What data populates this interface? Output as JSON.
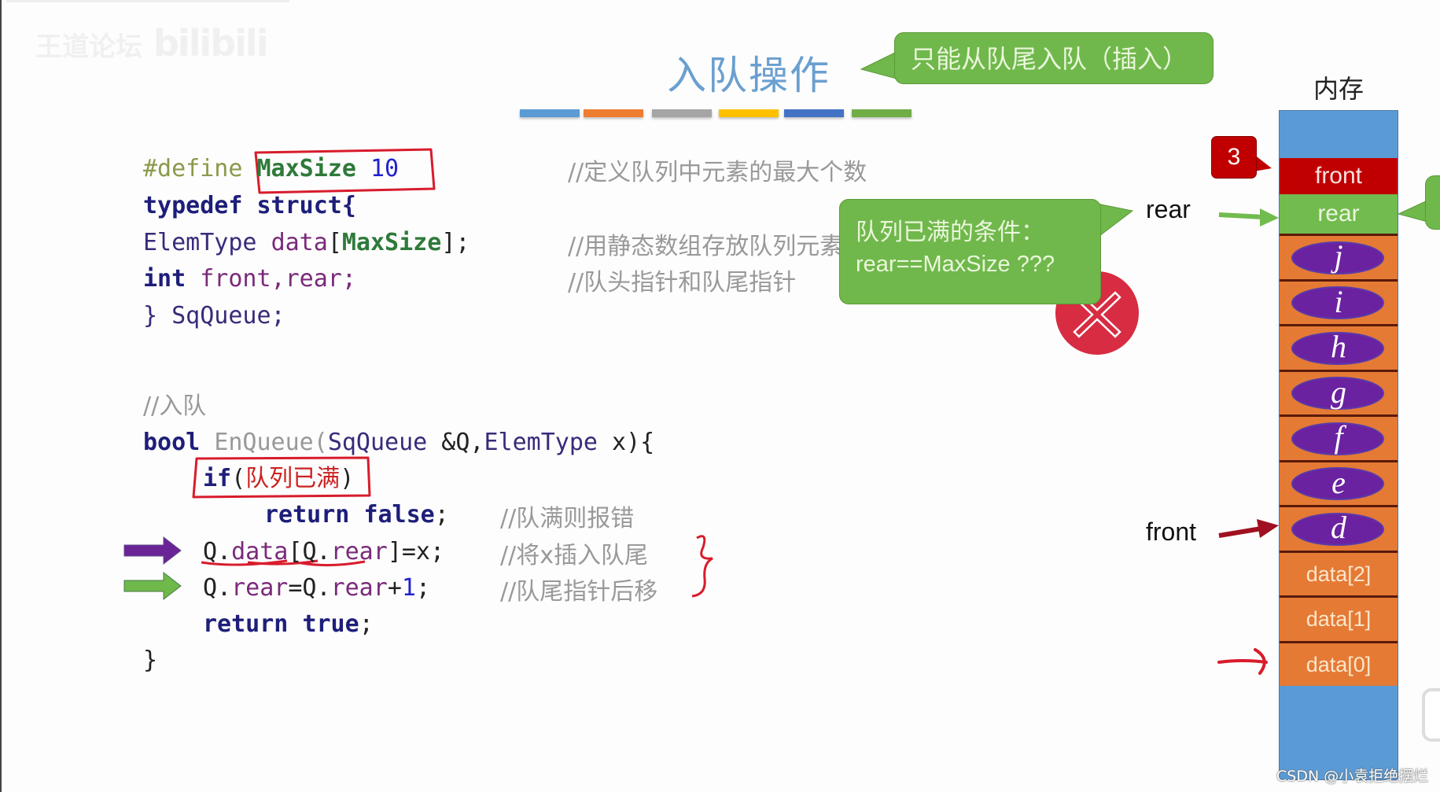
{
  "watermark": {
    "logo_cn": "王道论坛",
    "logo_en": "bilibili",
    "csdn": "CSDN @小袁拒绝摆烂"
  },
  "slide": {
    "title": "入队操作",
    "title_color": "#6a9fd0",
    "bar_colors": [
      "#5b9bd5",
      "#ed7d31",
      "#a5a5a5",
      "#ffc000",
      "#4472c4",
      "#70ad47"
    ],
    "callout_top": "只能从队尾入队（插入）",
    "callout_full_line1": "队列已满的条件：",
    "callout_full_line2": "rear==MaxSize ???",
    "error_icon": "x-circle-icon"
  },
  "code": {
    "define_kw": "#define",
    "define_name": "MaxSize",
    "define_val": "10",
    "typedef_line": "typedef struct{",
    "elemtype": "ElemType",
    "data_field": "data",
    "maxsize_ref": "MaxSize",
    "int_kw": "int",
    "front_rear": "front,rear;",
    "close_struct": "} SqQueue;",
    "comment_enqueue": "//入队",
    "bool_kw": "bool",
    "fn_name": "EnQueue",
    "params_type": "SqQueue",
    "params_rest": " &Q,",
    "params_type2": "ElemType",
    "params_end": " x){",
    "if_kw": "if",
    "if_cond": "队列已满",
    "return_kw": "return",
    "false_kw": "false",
    "q_prefix": "Q.",
    "q_data": "data",
    "q_rear": "rear",
    "assign_x": "]=x;",
    "rear_incr_mid": "=Q.",
    "rear_incr_one": "1",
    "true_kw": "true",
    "close_fn": "}",
    "comments": {
      "define": "//定义队列中元素的最大个数",
      "data": "//用静态数组存放队列元素",
      "ptrs": "//队头指针和队尾指针",
      "ret_false": "//队满则报错",
      "insert": "//将x插入队尾",
      "move": "//队尾指针后移"
    }
  },
  "memory": {
    "label": "内存",
    "badge_value": "3",
    "front_cell": "front",
    "rear_cell": "rear",
    "elements": [
      "j",
      "i",
      "h",
      "g",
      "f",
      "e",
      "d"
    ],
    "empty_cells": [
      "data[2]",
      "data[1]",
      "data[0]"
    ],
    "rear_pointer_label": "rear",
    "front_pointer_label": "front"
  }
}
